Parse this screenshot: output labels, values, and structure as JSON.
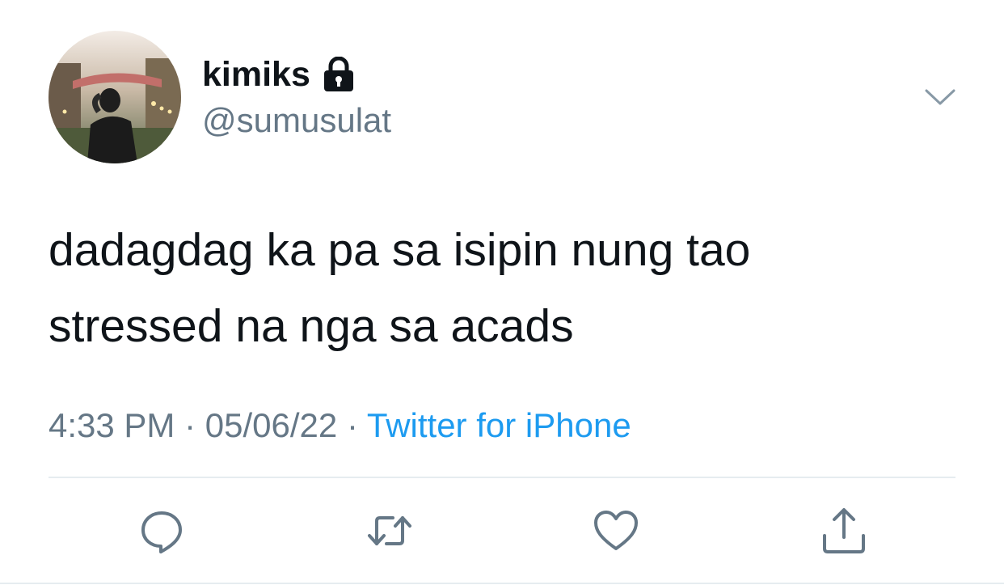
{
  "author": {
    "display_name": "kimiks",
    "handle": "@sumusulat",
    "protected_icon": "lock-icon",
    "avatar": "profile-photo"
  },
  "tweet": {
    "text_lines": [
      "dadagdag ka pa sa isipin nung tao",
      "stressed na nga sa acads"
    ]
  },
  "meta": {
    "time": "4:33 PM",
    "separator": "·",
    "date": "05/06/22",
    "source": "Twitter for iPhone"
  },
  "actions": [
    {
      "icon": "reply-icon"
    },
    {
      "icon": "retweet-icon"
    },
    {
      "icon": "like-icon"
    },
    {
      "icon": "share-icon"
    }
  ],
  "colors": {
    "text": "#0f1419",
    "secondary": "#657786",
    "link": "#1d9bf0",
    "divider": "#e6ecf0"
  }
}
